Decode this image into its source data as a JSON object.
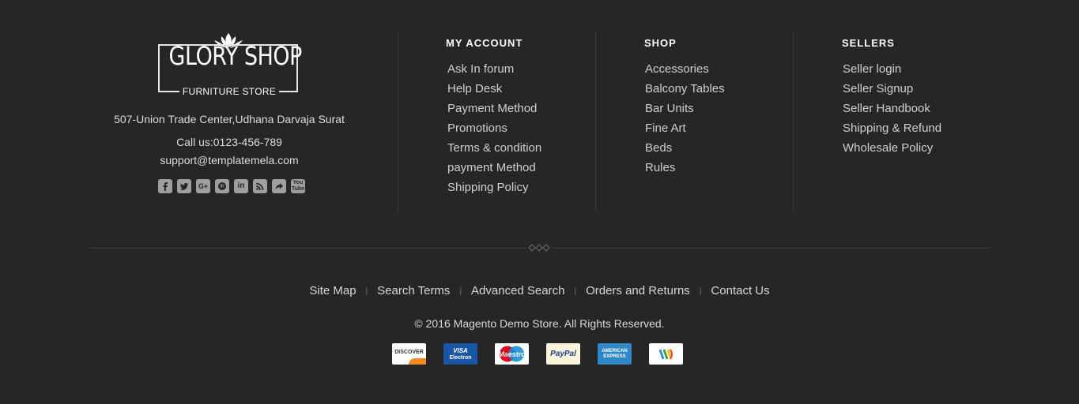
{
  "brand": {
    "title": "GLORY SHOP",
    "subtitle": "FURNITURE STORE"
  },
  "contact": {
    "address": "507-Union Trade Center,Udhana Darvaja Surat",
    "phone": "Call us:0123-456-789",
    "email": "support@templatemela.com"
  },
  "social": [
    {
      "icon": "facebook-icon",
      "glyph": "f"
    },
    {
      "icon": "twitter-icon",
      "glyph": "t"
    },
    {
      "icon": "google-plus-icon",
      "glyph": "G+"
    },
    {
      "icon": "pinterest-icon",
      "glyph": "P"
    },
    {
      "icon": "linkedin-icon",
      "glyph": "in"
    },
    {
      "icon": "rss-icon",
      "glyph": "rss"
    },
    {
      "icon": "share-icon",
      "glyph": "↪"
    },
    {
      "icon": "youtube-icon",
      "glyph": "You"
    }
  ],
  "columns": [
    {
      "heading": "MY ACCOUNT",
      "items": [
        "Ask In forum",
        "Help Desk",
        "Payment Method",
        "Promotions",
        "Terms & condition",
        "payment Method",
        "Shipping Policy"
      ]
    },
    {
      "heading": "SHOP",
      "items": [
        "Accessories",
        "Balcony Tables",
        "Bar Units",
        "Fine Art",
        "Beds",
        "Rules"
      ]
    },
    {
      "heading": "SELLERS",
      "items": [
        "Seller login",
        "Seller Signup",
        "Seller Handbook",
        "Shipping & Refund",
        "Wholesale Policy"
      ]
    }
  ],
  "bottom_links": [
    "Site Map",
    "Search Terms",
    "Advanced Search",
    "Orders and Returns",
    "Contact Us"
  ],
  "separator": "|",
  "copyright": "© 2016 Magento Demo Store. All Rights Reserved.",
  "payment_cards": {
    "discover": "DISCOVER",
    "visa_top": "VISA",
    "visa_bottom": "Electron",
    "maestro": "Maestro",
    "paypal": "PayPal",
    "amex_top": "AMERICAN",
    "amex_bottom": "EXPRESS"
  },
  "colors": {
    "background": "#262626",
    "text": "#cfcfcf",
    "heading": "#ffffff"
  }
}
